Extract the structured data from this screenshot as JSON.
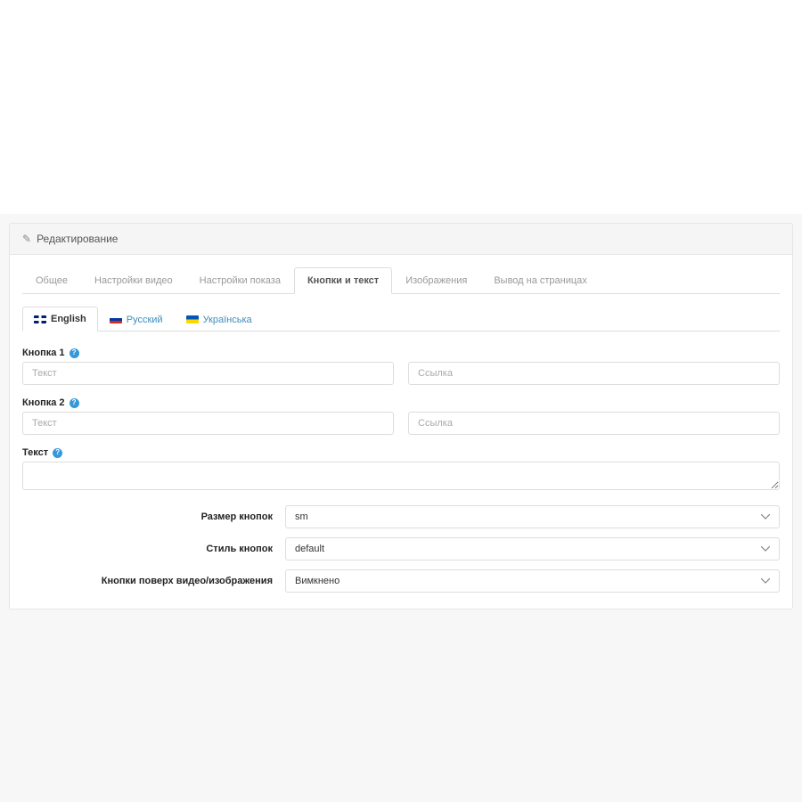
{
  "panel": {
    "title": "Редактирование"
  },
  "tabs": [
    {
      "label": "Общее"
    },
    {
      "label": "Настройки видео"
    },
    {
      "label": "Настройки показа"
    },
    {
      "label": "Кнопки и текст"
    },
    {
      "label": "Изображения"
    },
    {
      "label": "Вывод на страницах"
    }
  ],
  "langs": [
    {
      "label": "English"
    },
    {
      "label": "Русский"
    },
    {
      "label": "Українська"
    }
  ],
  "fields": {
    "button1": {
      "label": "Кнопка 1",
      "text_ph": "Текст",
      "link_ph": "Ссылка"
    },
    "button2": {
      "label": "Кнопка 2",
      "text_ph": "Текст",
      "link_ph": "Ссылка"
    },
    "text": {
      "label": "Текст"
    },
    "size": {
      "label": "Размер кнопок",
      "value": "sm"
    },
    "style": {
      "label": "Стиль кнопок",
      "value": "default"
    },
    "overlay": {
      "label": "Кнопки поверх видео/изображения",
      "value": "Вимкнено"
    }
  }
}
